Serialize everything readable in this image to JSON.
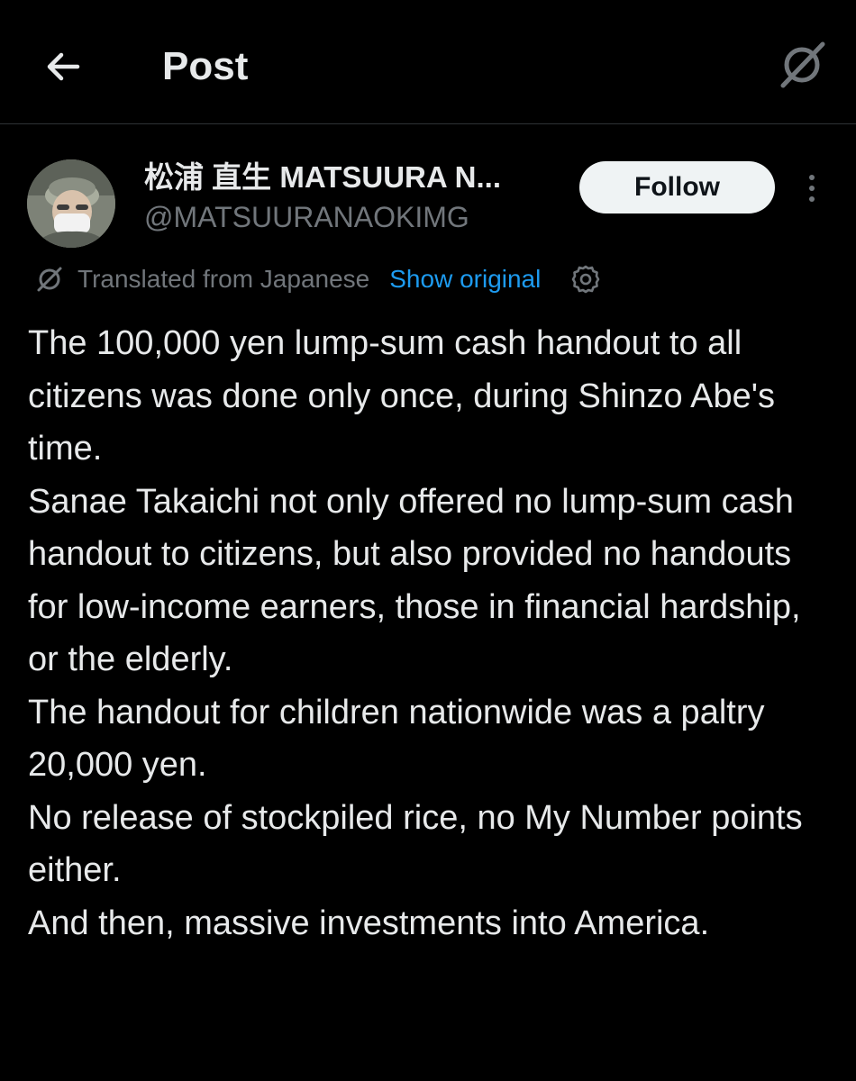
{
  "header": {
    "title": "Post",
    "back_icon": "arrow-left-icon",
    "grok_icon": "grok-icon"
  },
  "author": {
    "display_name": "松浦 直生 MATSUURA N...",
    "handle": "@MATSUURANAOKIMG",
    "avatar": "avatar-photo",
    "follow_label": "Follow",
    "more_icon": "more-vertical-icon"
  },
  "translation": {
    "label": "Translated from Japanese",
    "show_original": "Show original",
    "icon": "translate-icon",
    "settings_icon": "gear-icon"
  },
  "post": {
    "paragraphs": [
      "The 100,000 yen lump-sum cash handout to all citizens was done only once, during Shinzo Abe's time.",
      "Sanae Takaichi not only offered no lump-sum cash handout to citizens, but also provided no handouts for low-income earners, those in financial hardship, or the elderly.",
      "The handout for children nationwide was a paltry 20,000 yen.",
      "No release of stockpiled rice, no My Number points either.",
      "And then, massive investments into America."
    ]
  },
  "colors": {
    "background": "#000000",
    "text": "#e7e9ea",
    "secondary": "#71767b",
    "link": "#1d9bf0",
    "follow_bg": "#eff3f4",
    "divider": "#2f3336"
  }
}
